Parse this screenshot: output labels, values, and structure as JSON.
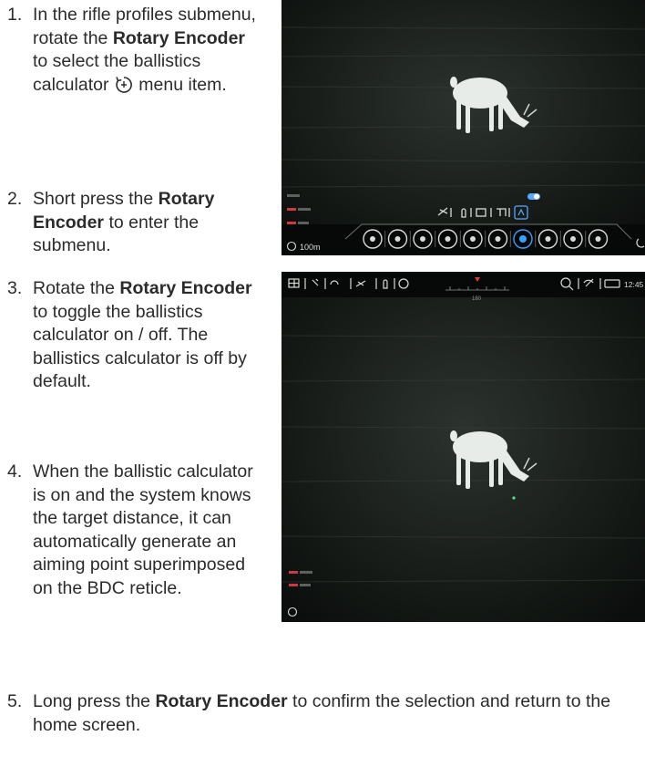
{
  "steps": [
    {
      "num": "1.",
      "segments": [
        "In the rifle profiles submenu, rotate the ",
        "Rotary Encoder",
        " to select the ballistics calculator ",
        " menu item."
      ],
      "icon": "ballistics-calculator-icon"
    },
    {
      "num": "2.",
      "segments": [
        "Short press the ",
        "Rotary Encoder",
        " to enter the submenu."
      ]
    },
    {
      "num": "3.",
      "segments": [
        "Rotate the ",
        "Rotary Encoder",
        " to toggle the ballistics calculator on / off. The ballistics calculator is off by default."
      ]
    },
    {
      "num": "4.",
      "text": "When the ballistic calculator is on and the system knows the target distance, it can automatically generate an aiming point superimposed on the BDC reticle."
    },
    {
      "num": "5.",
      "segments": [
        "Long press the ",
        "Rotary Encoder",
        " to confirm the selection and return to the home screen."
      ]
    }
  ],
  "screen1": {
    "range_readout": "100m",
    "menu_icons": [
      "wifi-icon",
      "compass-icon",
      "microphone-icon",
      "night-mode-icon",
      "camera-icon",
      "cloud-icon",
      "ballistics-icon",
      "reticle-icon",
      "gallery-icon",
      "settings-icon"
    ],
    "selected_icon": "ballistics-icon",
    "submenu_icons": [
      "rifle-icon",
      "bullet-icon",
      "grid-icon",
      "range-icon",
      "ballistics-calculator-icon"
    ]
  },
  "screen2": {
    "status_left": [
      "grid-icon",
      "wind-icon",
      "weather-icon",
      "rifle-icon",
      "bullet-icon",
      "settings-icon"
    ],
    "status_right": [
      "zoom-icon",
      "wifi-off-icon",
      "battery-icon"
    ],
    "time": "12:45",
    "compass_value": "180"
  },
  "colors": {
    "accent": "#3aa0ff",
    "marker": "#e23b3b",
    "screen_bg": "#121613"
  }
}
